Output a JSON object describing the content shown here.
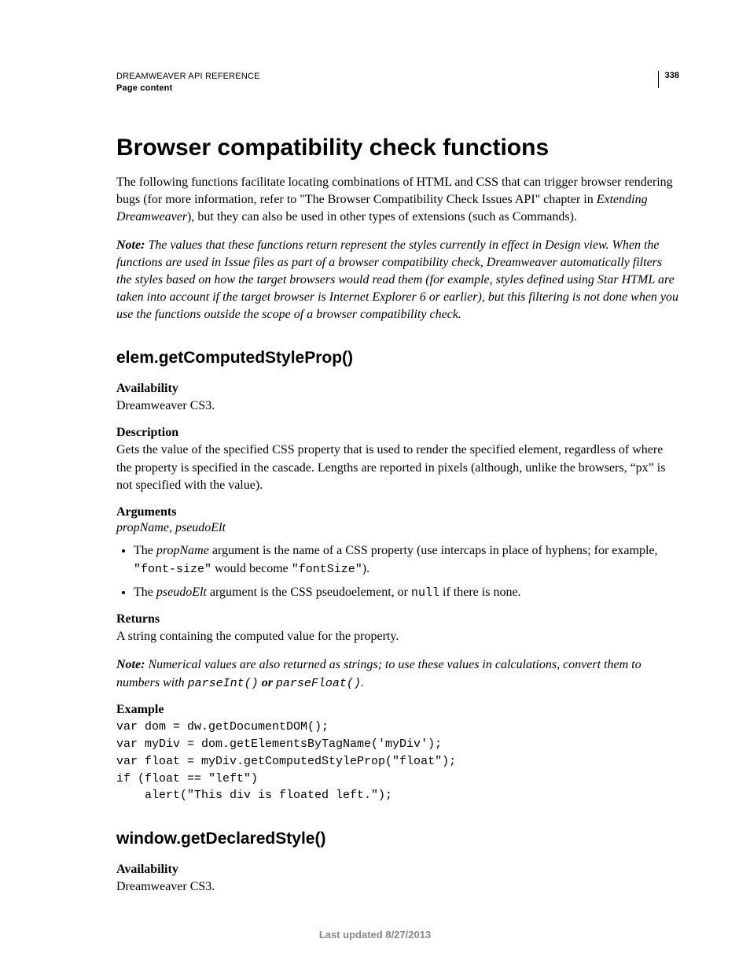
{
  "header": {
    "doc_title": "DREAMWEAVER API REFERENCE",
    "section": "Page content",
    "page_number": "338"
  },
  "title": "Browser compatibility check functions",
  "intro": {
    "p1_a": "The following functions facilitate locating combinations of HTML and CSS that can trigger browser rendering bugs (for more information, refer to \"The Browser Compatibility Check Issues API\" chapter in ",
    "p1_b": "Extending Dreamweaver",
    "p1_c": "), but they can also be used in other types of extensions (such as Commands).",
    "note_label": "Note:",
    "note_body": " The values that these functions return represent the styles currently in effect in Design view. When the functions are used in Issue files as part of a browser compatibility check, Dreamweaver automatically filters the styles based on how the target browsers would read them (for example, styles defined using Star HTML are taken into account if the target browser is Internet Explorer 6 or earlier), but this filtering is not done when you use the functions outside the scope of a browser compatibility check."
  },
  "func1": {
    "name": "elem.getComputedStyleProp()",
    "availability_h": "Availability",
    "availability_v": "Dreamweaver CS3.",
    "description_h": "Description",
    "description_v": "Gets the value of the specified CSS property that is used to render the specified element, regardless of where the property is specified in the cascade. Lengths are reported in pixels (although, unlike the browsers, “px” is not specified with the value).",
    "arguments_h": "Arguments",
    "arguments_line": "propName, pseudoElt",
    "arg1_a": "The ",
    "arg1_b": "propName",
    "arg1_c": " argument is the name of a CSS property (use intercaps in place of hyphens; for example, ",
    "arg1_d": "\"font-size\"",
    "arg1_e": " would become ",
    "arg1_f": "\"fontSize\"",
    "arg1_g": ").",
    "arg2_a": "The ",
    "arg2_b": "pseudoElt",
    "arg2_c": " argument is the CSS pseudoelement, or ",
    "arg2_d": "null",
    "arg2_e": " if there is none.",
    "returns_h": "Returns",
    "returns_v": "A string containing the computed value for the property.",
    "note_label": "Note:",
    "note_a": " Numerical values are also returned as strings; to use these values in calculations, convert them to numbers with ",
    "note_b": "parseInt()",
    "note_c": " or ",
    "note_d": "parseFloat()",
    "note_e": ".",
    "example_h": "Example",
    "example_code": "var dom = dw.getDocumentDOM(); \nvar myDiv = dom.getElementsByTagName('myDiv'); \nvar float = myDiv.getComputedStyleProp(\"float\"); \nif (float == \"left\") \n    alert(\"This div is floated left.\");"
  },
  "func2": {
    "name": "window.getDeclaredStyle()",
    "availability_h": "Availability",
    "availability_v": "Dreamweaver CS3."
  },
  "footer": "Last updated 8/27/2013"
}
